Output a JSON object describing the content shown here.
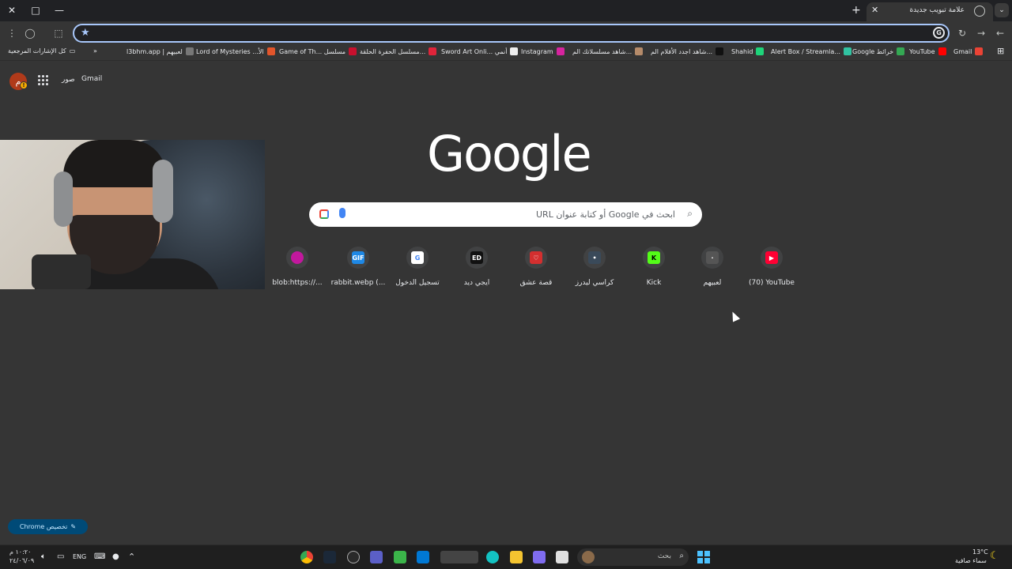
{
  "tab": {
    "title": "علامة تبويب جديدة",
    "close": "✕",
    "new_tab": "+"
  },
  "window": {
    "close": "✕",
    "maximize": "□",
    "minimize": "—"
  },
  "toolbar": {
    "menu": "⋮",
    "profile": "◯",
    "extensions": "⬚",
    "reload": "↻",
    "back": "←",
    "forward": "→",
    "star": "★",
    "google_g": "G"
  },
  "bookmarks": {
    "all_bookmarks": "كل الإشارات المرجعية",
    "overflow": "»",
    "apps": "⊞",
    "items": [
      {
        "label": "Gmail",
        "color": "#ea4335"
      },
      {
        "label": "YouTube",
        "color": "#ff0000"
      },
      {
        "label": "Google خرائط",
        "color": "#34a853"
      },
      {
        "label": "Alert Box / Streamla...",
        "color": "#31c3a2"
      },
      {
        "label": "Shahid",
        "color": "#1ed47a"
      },
      {
        "label": "شاهد اجدد الأفلام الم...",
        "color": "#111111"
      },
      {
        "label": "شاهد مسلسلاتك الم...",
        "color": "#b58b6a"
      },
      {
        "label": "Instagram",
        "color": "#d6249f"
      },
      {
        "label": "Sword Art Onli... أنمي",
        "color": "#eeeeee"
      },
      {
        "label": "مسلسل الحفرة الحلقة...",
        "color": "#e0243a"
      },
      {
        "label": "Game of Th... مسلسل",
        "color": "#c8102e"
      },
      {
        "label": "Lord of Mysteries ...الأ",
        "color": "#e2552b"
      },
      {
        "label": "l3bhm.app | لعبيهم",
        "color": "#777777"
      }
    ]
  },
  "header": {
    "gmail": "Gmail",
    "images": "صور",
    "avatar_letter": "م",
    "badge": "!"
  },
  "logo": "Google",
  "search": {
    "placeholder": "ابحث في Google أو كتابة عنوان URL",
    "search_icon": "⌕"
  },
  "shortcuts": [
    {
      "label": "blob:https://...",
      "icon_color": "#c2189d",
      "icon_text": ""
    },
    {
      "label": "rabbit.webp (...",
      "icon_color": "#1e88e5",
      "icon_text": "GIF"
    },
    {
      "label": "تسجيل الدخول",
      "icon_color": "#ffffff",
      "icon_text": "G"
    },
    {
      "label": "ايجي ديد",
      "icon_color": "#111111",
      "icon_text": "ED"
    },
    {
      "label": "قصة عشق",
      "icon_color": "#d32f2f",
      "icon_text": "♡"
    },
    {
      "label": "كراسي ليدرز",
      "icon_color": "#3a4a5a",
      "icon_text": "•"
    },
    {
      "label": "Kick",
      "icon_color": "#53fc18",
      "icon_text": "K"
    },
    {
      "label": "لعبيهم",
      "icon_color": "#555555",
      "icon_text": "·"
    },
    {
      "label": "(70) YouTube",
      "icon_color": "#ff0033",
      "icon_text": "▶"
    }
  ],
  "customize": {
    "label": "تخصيص Chrome",
    "icon": "✎"
  },
  "taskbar": {
    "time": "١٠:٢٠ م",
    "date": "٢٤/٠٦/٠٩",
    "lang": "ENG",
    "search_placeholder": "بحث",
    "weather_temp": "13°C",
    "weather_desc": "سماء صافية",
    "chevron": "⌃"
  }
}
